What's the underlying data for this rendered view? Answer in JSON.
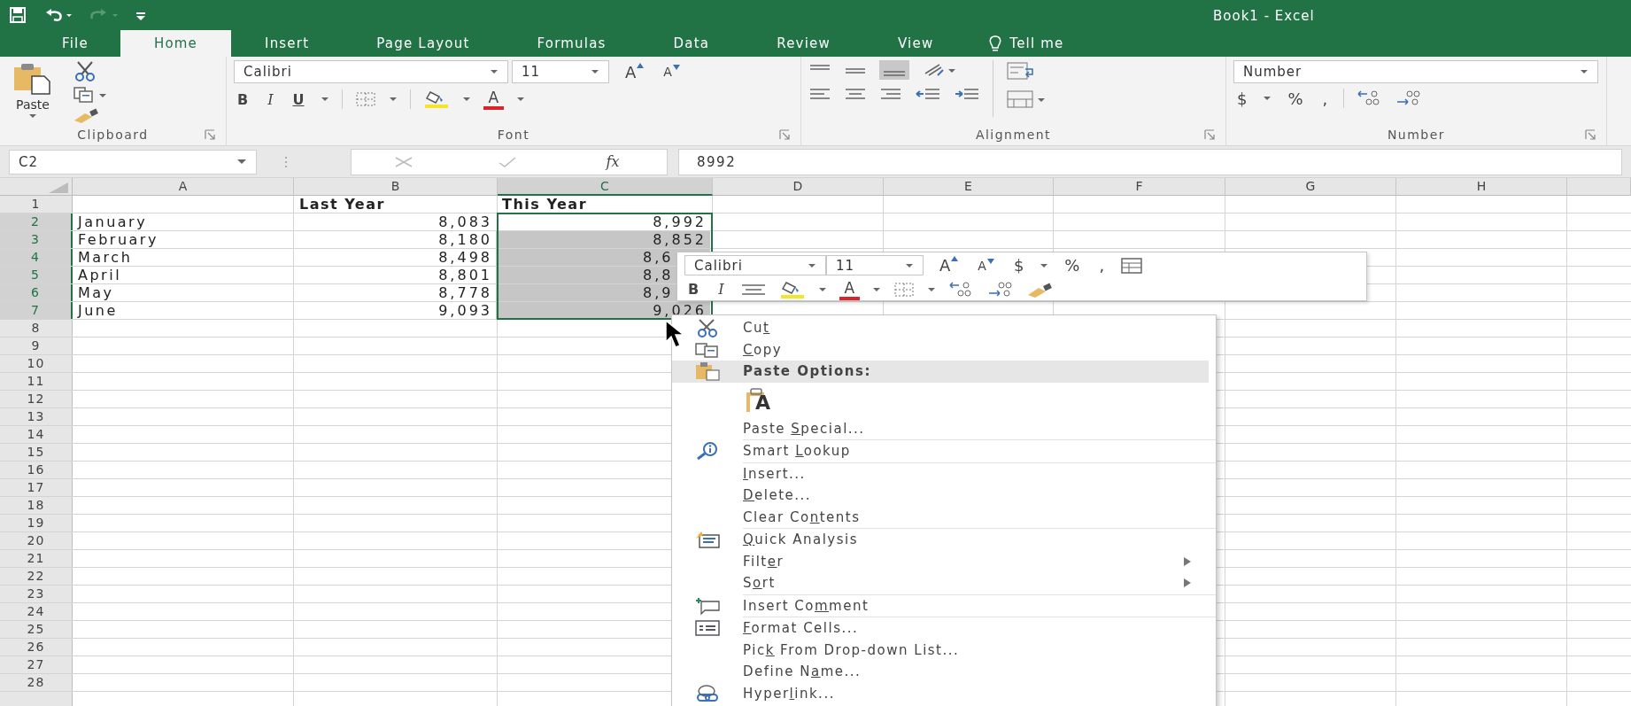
{
  "window": {
    "title": "Book1 - Excel"
  },
  "tabs": [
    {
      "label": "File",
      "selected": false
    },
    {
      "label": "Home",
      "selected": true
    },
    {
      "label": "Insert",
      "selected": false
    },
    {
      "label": "Page Layout",
      "selected": false
    },
    {
      "label": "Formulas",
      "selected": false
    },
    {
      "label": "Data",
      "selected": false
    },
    {
      "label": "Review",
      "selected": false
    },
    {
      "label": "View",
      "selected": false
    }
  ],
  "tell_me": "Tell me",
  "ribbon": {
    "clipboard": {
      "paste_label": "Paste",
      "group_label": "Clipboard"
    },
    "font": {
      "font_name": "Calibri",
      "font_size": "11",
      "grow": "A",
      "shrink": "A",
      "bold": "B",
      "italic": "I",
      "underline": "U",
      "color_letter": "A",
      "group_label": "Font"
    },
    "alignment": {
      "group_label": "Alignment"
    },
    "number": {
      "format": "Number",
      "currency": "$",
      "percent": "%",
      "comma": ",",
      "group_label": "Number"
    }
  },
  "formula_bar": {
    "name_box": "C2",
    "function_label": "fx",
    "value": "8992"
  },
  "columns": [
    {
      "label": "A",
      "selected": false
    },
    {
      "label": "B",
      "selected": false
    },
    {
      "label": "C",
      "selected": true
    },
    {
      "label": "D",
      "selected": false
    },
    {
      "label": "E",
      "selected": false
    },
    {
      "label": "F",
      "selected": false
    },
    {
      "label": "G",
      "selected": false
    },
    {
      "label": "H",
      "selected": false
    }
  ],
  "rows": [
    {
      "number": "1",
      "selected": false,
      "cells": {
        "b": {
          "text": "Last Year",
          "kind": "heading",
          "selected": false
        },
        "c": {
          "text": "This Year",
          "kind": "heading",
          "selected": false
        }
      }
    },
    {
      "number": "2",
      "selected": true,
      "cells": {
        "a": {
          "text": "January",
          "kind": "text",
          "selected": false
        },
        "b": {
          "text": "8,083",
          "kind": "number",
          "selected": false
        },
        "c": {
          "text": "8,992",
          "kind": "number",
          "selected": false
        }
      }
    },
    {
      "number": "3",
      "selected": true,
      "cells": {
        "a": {
          "text": "February",
          "kind": "text",
          "selected": false
        },
        "b": {
          "text": "8,180",
          "kind": "number",
          "selected": false
        },
        "c": {
          "text": "8,852",
          "kind": "number",
          "selected": true
        }
      }
    },
    {
      "number": "4",
      "selected": true,
      "cells": {
        "a": {
          "text": "March",
          "kind": "text",
          "selected": false
        },
        "b": {
          "text": "8,498",
          "kind": "number",
          "selected": false
        },
        "c": {
          "text": "8,6",
          "kind": "partial",
          "selected": true
        }
      }
    },
    {
      "number": "5",
      "selected": true,
      "cells": {
        "a": {
          "text": "April",
          "kind": "text",
          "selected": false
        },
        "b": {
          "text": "8,801",
          "kind": "number",
          "selected": false
        },
        "c": {
          "text": "8,8",
          "kind": "partial",
          "selected": true
        }
      }
    },
    {
      "number": "6",
      "selected": true,
      "cells": {
        "a": {
          "text": "May",
          "kind": "text",
          "selected": false
        },
        "b": {
          "text": "8,778",
          "kind": "number",
          "selected": false
        },
        "c": {
          "text": "8,9",
          "kind": "partial",
          "selected": true
        }
      }
    },
    {
      "number": "7",
      "selected": true,
      "cells": {
        "a": {
          "text": "June",
          "kind": "text",
          "selected": false
        },
        "b": {
          "text": "9,093",
          "kind": "number",
          "selected": false
        },
        "c": {
          "text": "9,026",
          "kind": "number",
          "selected": true
        }
      }
    },
    {
      "number": "8",
      "selected": false
    },
    {
      "number": "9",
      "selected": false
    },
    {
      "number": "10",
      "selected": false
    },
    {
      "number": "11",
      "selected": false
    },
    {
      "number": "12",
      "selected": false
    },
    {
      "number": "13",
      "selected": false
    },
    {
      "number": "14",
      "selected": false
    },
    {
      "number": "15",
      "selected": false
    },
    {
      "number": "16",
      "selected": false
    },
    {
      "number": "17",
      "selected": false
    },
    {
      "number": "18",
      "selected": false
    },
    {
      "number": "19",
      "selected": false
    },
    {
      "number": "20",
      "selected": false
    },
    {
      "number": "21",
      "selected": false
    },
    {
      "number": "22",
      "selected": false
    },
    {
      "number": "23",
      "selected": false
    },
    {
      "number": "24",
      "selected": false
    },
    {
      "number": "25",
      "selected": false
    },
    {
      "number": "26",
      "selected": false
    },
    {
      "number": "27",
      "selected": false
    },
    {
      "number": "28",
      "selected": false
    }
  ],
  "mini_toolbar": {
    "font_name": "Calibri",
    "font_size": "11",
    "grow": "A",
    "shrink": "A",
    "currency": "$",
    "percent": "%",
    "comma": ",",
    "bold": "B",
    "italic": "I",
    "color_letter": "A"
  },
  "context_menu": {
    "sections": [
      [
        {
          "kind": "cut",
          "before": "Cu",
          "key": "t"
        },
        {
          "kind": "copy",
          "key": "C",
          "after": "opy"
        },
        {
          "kind": "header",
          "before": "Paste Options:"
        },
        {
          "kind": "paste",
          "letter": "A"
        },
        {
          "kind": "plain",
          "before": "Paste ",
          "key": "S",
          "after": "pecial..."
        }
      ],
      [
        {
          "kind": "lookup",
          "before": "Smart ",
          "key": "L",
          "after": "ookup"
        }
      ],
      [
        {
          "kind": "plain",
          "key": "I",
          "after": "nsert..."
        },
        {
          "kind": "plain",
          "key": "D",
          "after": "elete..."
        },
        {
          "kind": "plain",
          "before": "Clear Co",
          "key": "n",
          "after": "tents"
        }
      ],
      [
        {
          "kind": "analysis",
          "key": "Q",
          "after": "uick Analysis"
        },
        {
          "kind": "submenu",
          "before": "Filt",
          "key": "e",
          "after": "r"
        },
        {
          "kind": "submenu",
          "before": "S",
          "key": "o",
          "after": "rt"
        }
      ],
      [
        {
          "kind": "comment",
          "before": "Insert Co",
          "key": "m",
          "after": "ment"
        }
      ],
      [
        {
          "kind": "format",
          "key": "F",
          "after": "ormat Cells..."
        },
        {
          "kind": "plain",
          "before": "Pic",
          "key": "k",
          "after": " From Drop-down List..."
        },
        {
          "kind": "plain",
          "before": "Define N",
          "key": "a",
          "after": "me..."
        },
        {
          "kind": "link",
          "before": "Hyper",
          "key": "l",
          "after": "ink..."
        }
      ]
    ]
  }
}
